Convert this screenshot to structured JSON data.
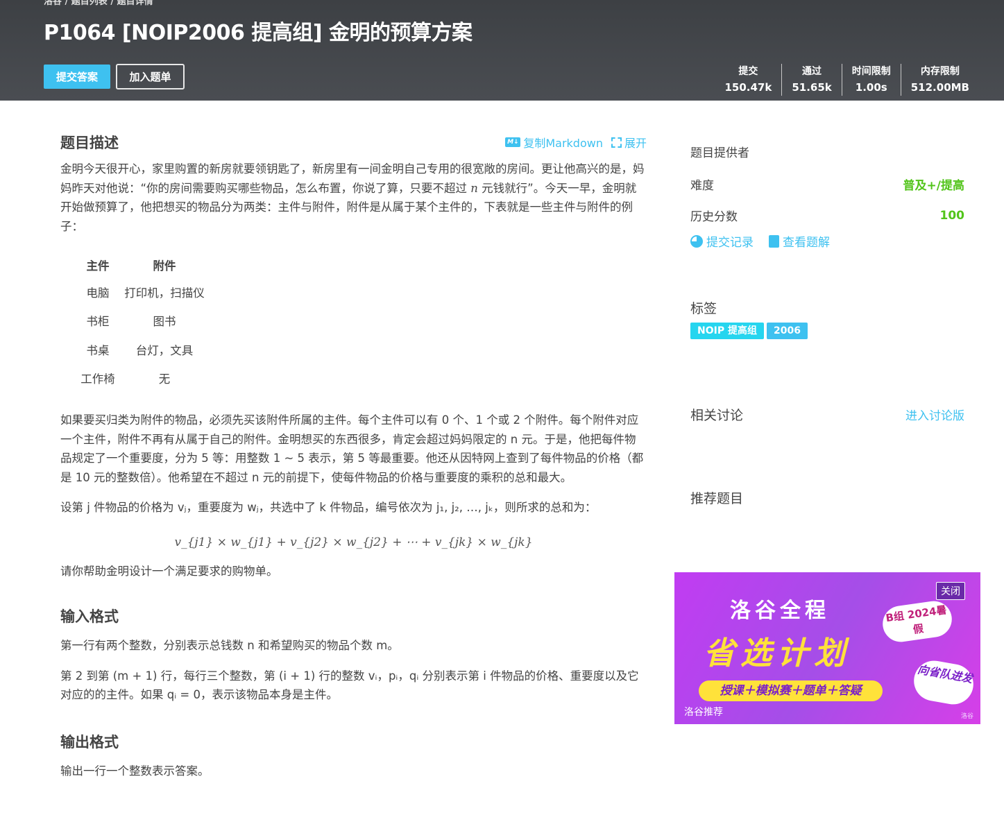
{
  "header": {
    "breadcrumb": "洛谷 / 题目列表 / 题目详情",
    "title": "P1064 [NOIP2006 提高组] 金明的预算方案",
    "submit_label": "提交答案",
    "addlist_label": "加入题单",
    "stats": [
      {
        "key": "提交",
        "value": "150.47k"
      },
      {
        "key": "通过",
        "value": "51.65k"
      },
      {
        "key": "时间限制",
        "value": "1.00s"
      },
      {
        "key": "内存限制",
        "value": "512.00MB"
      }
    ]
  },
  "main": {
    "desc_title": "题目描述",
    "copy_md": "复制Markdown",
    "expand": "展开",
    "p1_a": "金明今天很开心，家里购置的新房就要领钥匙了，新房里有一间金明自己专用的很宽敞的房间。更让他高兴的是，妈妈昨天对他说：“你的房间需要购买哪些物品，怎么布置，你说了算，只要不超过 ",
    "p1_n": "n",
    "p1_b": " 元钱就行”。今天一早，金明就开始做预算了，他把想买的物品分为两类：主件与附件，附件是从属于某个主件的，下表就是一些主件与附件的例子：",
    "table": {
      "headers": [
        "主件",
        "附件"
      ],
      "rows": [
        [
          "电脑",
          "打印机，扫描仪"
        ],
        [
          "书柜",
          "图书"
        ],
        [
          "书桌",
          "台灯，文具"
        ],
        [
          "工作椅",
          "无"
        ]
      ]
    },
    "p2": "如果要买归类为附件的物品，必须先买该附件所属的主件。每个主件可以有 0 个、1 个或 2 个附件。每个附件对应一个主件，附件不再有从属于自己的附件。金明想买的东西很多，肯定会超过妈妈限定的 n 元。于是，他把每件物品规定了一个重要度，分为 5 等：用整数 1 ~ 5 表示，第 5 等最重要。他还从因特网上查到了每件物品的价格（都是 10 元的整数倍）。他希望在不超过 n 元的前提下，使每件物品的价格与重要度的乘积的总和最大。",
    "p3": "设第 j 件物品的价格为 vⱼ，重要度为 wⱼ，共选中了 k 件物品，编号依次为 j₁, j₂, …, jₖ，则所求的总和为：",
    "formula": "v_{j1} × w_{j1} + v_{j2} × w_{j2} + ⋯ + v_{jk} × w_{jk}",
    "p4": "请你帮助金明设计一个满足要求的购物单。",
    "input_title": "输入格式",
    "input_p1": "第一行有两个整数，分别表示总钱数 n 和希望购买的物品个数 m。",
    "input_p2": "第 2 到第 (m + 1) 行，每行三个整数，第 (i + 1) 行的整数 vᵢ，pᵢ，qᵢ 分别表示第 i 件物品的价格、重要度以及它对应的的主件。如果 qᵢ = 0，表示该物品本身是主件。",
    "output_title": "输出格式",
    "output_p1": "输出一行一个整数表示答案。"
  },
  "sidebar": {
    "provider": "题目提供者",
    "difficulty_label": "难度",
    "difficulty_value": "普及+/提高",
    "history_label": "历史分数",
    "history_value": "100",
    "records": "提交记录",
    "solutions": "查看题解",
    "tags_title": "标签",
    "tags": [
      "NOIP 提高组",
      "2006"
    ],
    "discuss_title": "相关讨论",
    "discuss_link": "进入讨论版",
    "recommend_title": "推荐题目"
  },
  "ad": {
    "brand": "洛谷全程",
    "slogan": "省选计划",
    "bar": "授课＋模拟赛＋题单＋答疑",
    "bubble": "B组 2024暑假",
    "bubble2": "向省队进发",
    "close": "关闭",
    "rec": "洛谷推荐",
    "luogu": "洛谷"
  },
  "colors": {
    "accent": "#3ec1f0",
    "green": "#52c41a",
    "header_bg": "#45484c"
  }
}
